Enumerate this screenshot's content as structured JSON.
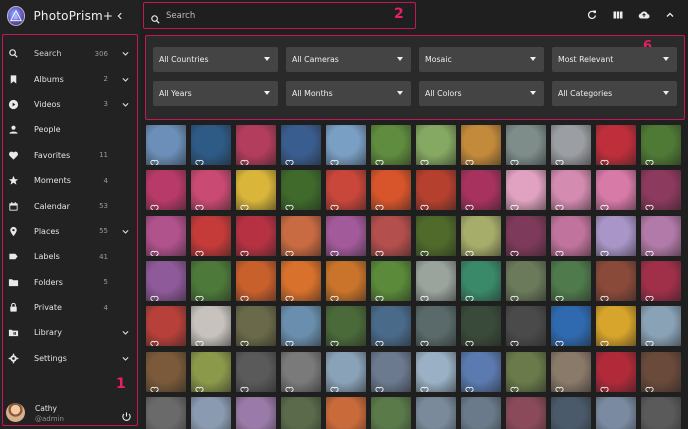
{
  "app": {
    "title": "PhotoPrism+"
  },
  "search": {
    "placeholder": "Search"
  },
  "annotations": {
    "sidebar": "1",
    "search": "2",
    "filters": "6"
  },
  "sidebar": {
    "items": [
      {
        "label": "Search",
        "count": "306",
        "icon": "search-icon",
        "chevron": true,
        "active": true
      },
      {
        "label": "Albums",
        "count": "2",
        "icon": "bookmark-icon",
        "chevron": true
      },
      {
        "label": "Videos",
        "count": "3",
        "icon": "play-circle-icon",
        "chevron": true
      },
      {
        "label": "People",
        "count": "",
        "icon": "person-icon",
        "chevron": false
      },
      {
        "label": "Favorites",
        "count": "11",
        "icon": "heart-icon",
        "chevron": false
      },
      {
        "label": "Moments",
        "count": "4",
        "icon": "star-icon",
        "chevron": false
      },
      {
        "label": "Calendar",
        "count": "53",
        "icon": "calendar-icon",
        "chevron": false
      },
      {
        "label": "Places",
        "count": "55",
        "icon": "place-icon",
        "chevron": true
      },
      {
        "label": "Labels",
        "count": "41",
        "icon": "label-icon",
        "chevron": false
      },
      {
        "label": "Folders",
        "count": "5",
        "icon": "folder-icon",
        "chevron": false
      },
      {
        "label": "Private",
        "count": "4",
        "icon": "lock-icon",
        "chevron": false
      },
      {
        "label": "Library",
        "count": "",
        "icon": "library-icon",
        "chevron": true
      },
      {
        "label": "Settings",
        "count": "",
        "icon": "gear-icon",
        "chevron": true
      }
    ],
    "user": {
      "name": "Cathy",
      "role": "@admin"
    }
  },
  "filters": [
    {
      "value": "All Countries"
    },
    {
      "value": "All Cameras"
    },
    {
      "value": "Mosaic"
    },
    {
      "value": "Most Relevant"
    },
    {
      "value": "All Years"
    },
    {
      "value": "All Months"
    },
    {
      "value": "All Colors"
    },
    {
      "value": "All Categories"
    }
  ],
  "toolbar_icons": [
    "refresh-icon",
    "view-column-icon",
    "upload-icon",
    "chevron-up-icon"
  ],
  "colors": {
    "accent": "#e91e63",
    "sidebar_bg": "#222222",
    "select_bg": "#444444",
    "page_bg": "#1f1f1f"
  },
  "photos": [
    [
      "#6b8fb8",
      "#2e5a86",
      "#b33d5c",
      "#3a5d8f",
      "#7a9fc4",
      "#5f8c3e",
      "#85a862",
      "#c48a3c",
      "#7e8d8a",
      "#9b9ea2",
      "#bf2f3b",
      "#4f7a36"
    ],
    [
      "#b83a68",
      "#c94a72",
      "#d9b53a",
      "#3f6a2c",
      "#c9463a",
      "#d8552c",
      "#b6402e",
      "#a8325e",
      "#e0a2c0",
      "#d48bb0",
      "#d77aa8",
      "#8c3a5d"
    ],
    [
      "#b0528c",
      "#c43b3a",
      "#b63242",
      "#c96b42",
      "#a35a9a",
      "#b34f4c",
      "#4f6a2b",
      "#a6ad6a",
      "#7d3a5a",
      "#c0739c",
      "#a995c7",
      "#b27aa8"
    ],
    [
      "#8e5a9a",
      "#4d7a3a",
      "#c8602c",
      "#d7712c",
      "#c9742a",
      "#5a8a3a",
      "#9aa39c",
      "#3a8a6a",
      "#6a7a5a",
      "#4f7a4c",
      "#8a4a3a",
      "#a0304a"
    ],
    [
      "#b7403a",
      "#c7c2bd",
      "#6a6a4a",
      "#6a8fae",
      "#4a6a3a",
      "#4a6a8a",
      "#5a6a6a",
      "#3a4a3a",
      "#4a4a4a",
      "#2f6ab0",
      "#d7a42c",
      "#8aa2b6"
    ],
    [
      "#7a5a3a",
      "#8a9a4a",
      "#5a5a5a",
      "#7a7a7a",
      "#8aa2b8",
      "#6b7a8f",
      "#9ab0c4",
      "#5a7ab0",
      "#6a7a4a",
      "#8a7a6a",
      "#b02a3a",
      "#6a4a3a"
    ],
    [
      "#6a6a6a",
      "#8a9ab0",
      "#9a7aa8",
      "#5a6a4a",
      "#c96a3a",
      "#5a7a4a",
      "#7a8a9a",
      "#6a7a8a",
      "#8a4a5a",
      "#4a5a6a",
      "#7a8aa0",
      "#5a5a5a"
    ]
  ]
}
